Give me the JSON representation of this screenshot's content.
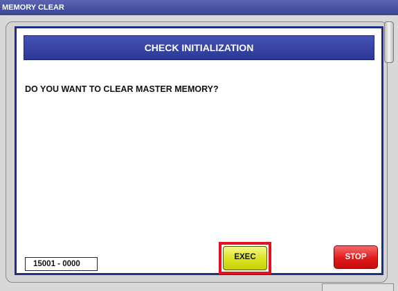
{
  "window": {
    "title": "MEMORY CLEAR"
  },
  "dialog": {
    "header": "CHECK INITIALIZATION",
    "question": "DO YOU WANT TO CLEAR MASTER MEMORY?",
    "code": "15001 - 0000",
    "exec_label": "EXEC",
    "stop_label": "STOP"
  },
  "colors": {
    "title_bar": "#3a4496",
    "dialog_border": "#1f2d8a",
    "header": "#2c3896",
    "exec_button": "#d9e31f",
    "exec_highlight": "#e3101f",
    "stop_button": "#df1b1b"
  }
}
